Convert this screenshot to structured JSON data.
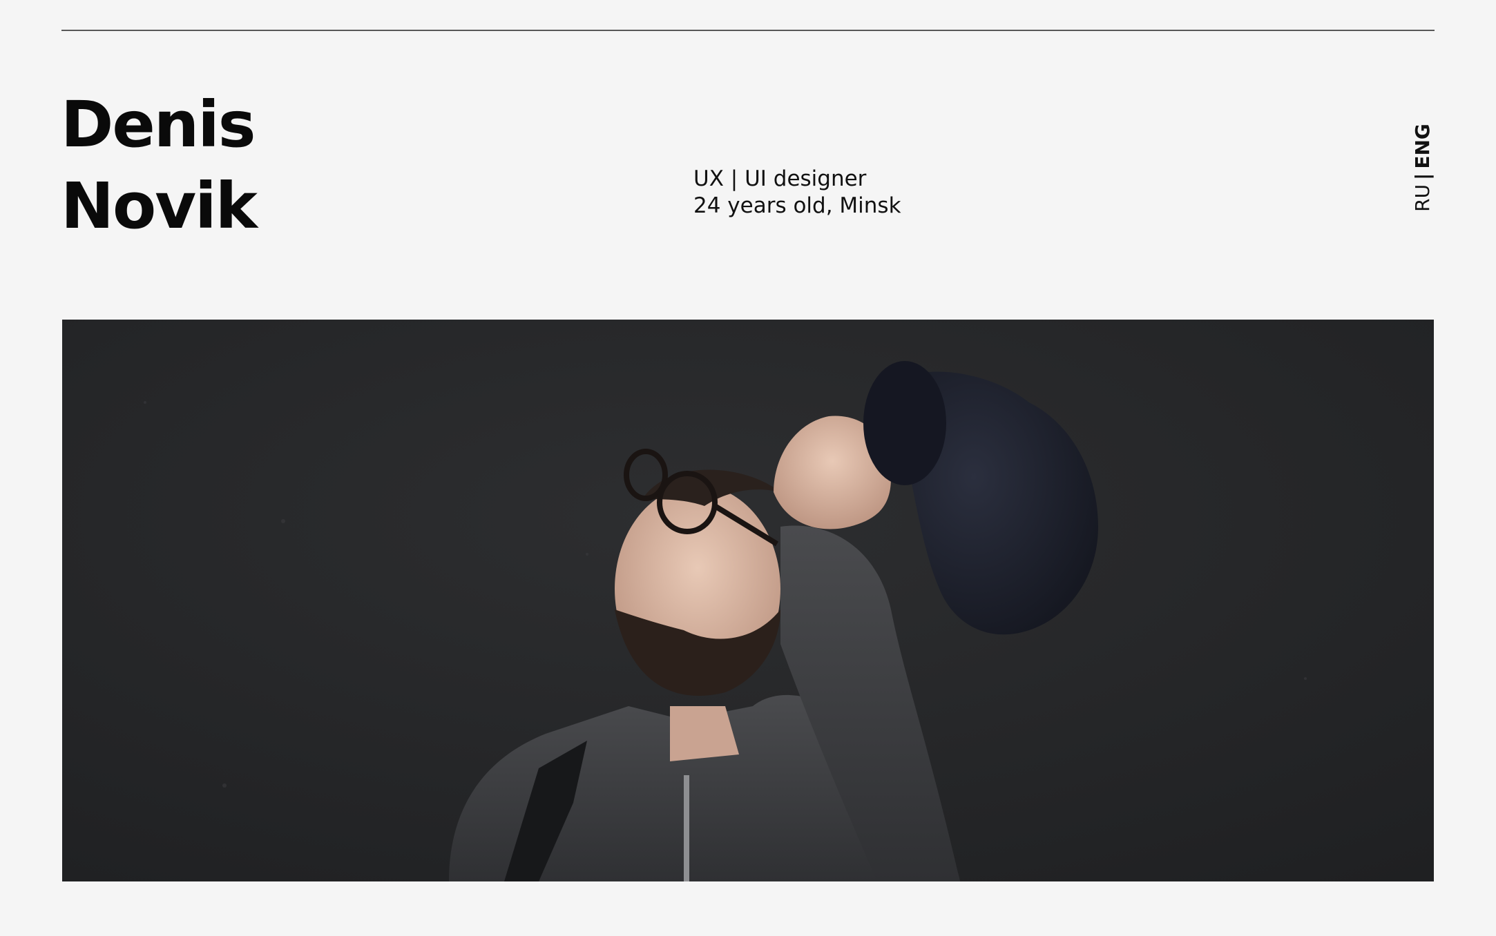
{
  "header": {
    "first_name": "Denis",
    "last_name": "Novik"
  },
  "bio": {
    "role": "UX | UI designer",
    "details": "24 years old, Minsk"
  },
  "language_switch": {
    "ru_label": "RU",
    "separator": "|",
    "eng_label": "ENG",
    "active": "ENG"
  },
  "hero": {
    "image": "portrait-photo"
  },
  "colors": {
    "background": "#f5f5f5",
    "text": "#0b0b0b",
    "rule": "#585858",
    "photo_wall": "#262729"
  }
}
